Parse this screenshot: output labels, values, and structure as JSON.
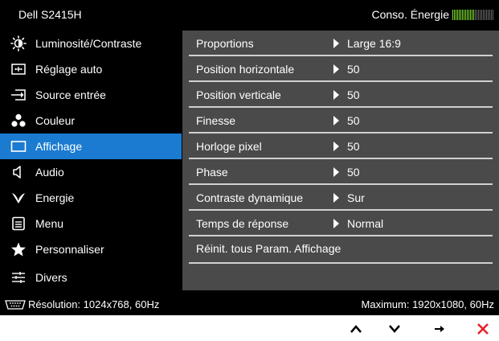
{
  "header": {
    "model": "Dell S2415H",
    "energy_label": "Conso. Énergie",
    "energy_level": 0.55
  },
  "sidebar": {
    "items": [
      {
        "label": "Luminosité/Contraste",
        "icon": "brightness-icon",
        "active": false
      },
      {
        "label": "Réglage auto",
        "icon": "auto-adjust-icon",
        "active": false
      },
      {
        "label": "Source entrée",
        "icon": "input-source-icon",
        "active": false
      },
      {
        "label": "Couleur",
        "icon": "color-icon",
        "active": false
      },
      {
        "label": "Affichage",
        "icon": "display-icon",
        "active": true
      },
      {
        "label": "Audio",
        "icon": "speaker-icon",
        "active": false
      },
      {
        "label": "Energie",
        "icon": "energy-icon",
        "active": false
      },
      {
        "label": "Menu",
        "icon": "menu-icon",
        "active": false
      },
      {
        "label": "Personnaliser",
        "icon": "star-icon",
        "active": false
      },
      {
        "label": "Divers",
        "icon": "sliders-icon",
        "active": false
      }
    ]
  },
  "settings": {
    "rows": [
      {
        "label": "Proportions",
        "value": "Large 16:9"
      },
      {
        "label": "Position horizontale",
        "value": "50"
      },
      {
        "label": "Position verticale",
        "value": "50"
      },
      {
        "label": "Finesse",
        "value": "50"
      },
      {
        "label": "Horloge pixel",
        "value": "50"
      },
      {
        "label": "Phase",
        "value": "50"
      },
      {
        "label": "Contraste dynamique",
        "value": "Sur"
      },
      {
        "label": "Temps de réponse",
        "value": "Normal"
      },
      {
        "label": "Réinit. tous Param. Affichage",
        "value": ""
      }
    ]
  },
  "footer": {
    "resolution": "Résolution: 1024x768, 60Hz",
    "maximum": "Maximum: 1920x1080, 60Hz"
  },
  "nav": {
    "buttons": [
      {
        "icon": "arrow-up-icon"
      },
      {
        "icon": "arrow-down-icon"
      },
      {
        "icon": "arrow-right-icon"
      },
      {
        "icon": "close-icon"
      }
    ],
    "close_color": "#e8202a"
  },
  "colors": {
    "active": "#1a7bd0",
    "panel": "#4a4a4a",
    "meter_on": "#7fdc2c"
  }
}
